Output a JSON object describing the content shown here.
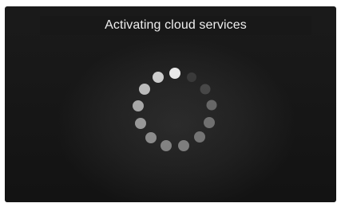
{
  "dialog": {
    "title": "Activating cloud services"
  },
  "spinner": {
    "name": "loading-spinner",
    "dot_count": 13,
    "active_index": 0,
    "colors": {
      "background": "#161616",
      "active_dot": "#f4f4f4",
      "bright_dot": "#cfcfcf",
      "mid_dot": "#9a9a9a",
      "dim_dot": "#4a4a4a"
    }
  }
}
